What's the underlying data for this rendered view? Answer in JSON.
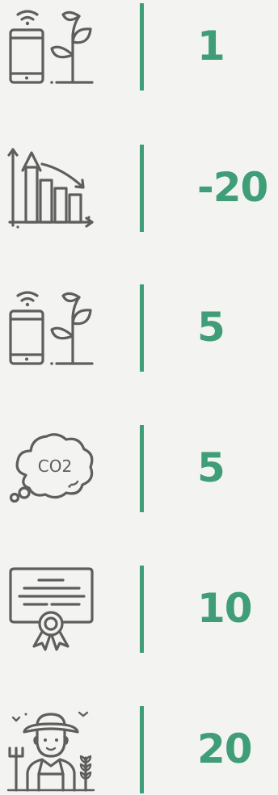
{
  "stats": [
    {
      "icon": "smart-farming-phone-plant-icon",
      "value": "1"
    },
    {
      "icon": "declining-bar-chart-icon",
      "value": "-20"
    },
    {
      "icon": "smart-farming-phone-plant-icon",
      "value": "5"
    },
    {
      "icon": "co2-cloud-icon",
      "value": "5",
      "icon_label": "CO2"
    },
    {
      "icon": "certificate-icon",
      "value": "10"
    },
    {
      "icon": "farmer-icon",
      "value": "20"
    }
  ],
  "colors": {
    "background": "#f3f3f1",
    "accent": "#3f9d78",
    "icon_stroke": "#5e5e5e"
  }
}
